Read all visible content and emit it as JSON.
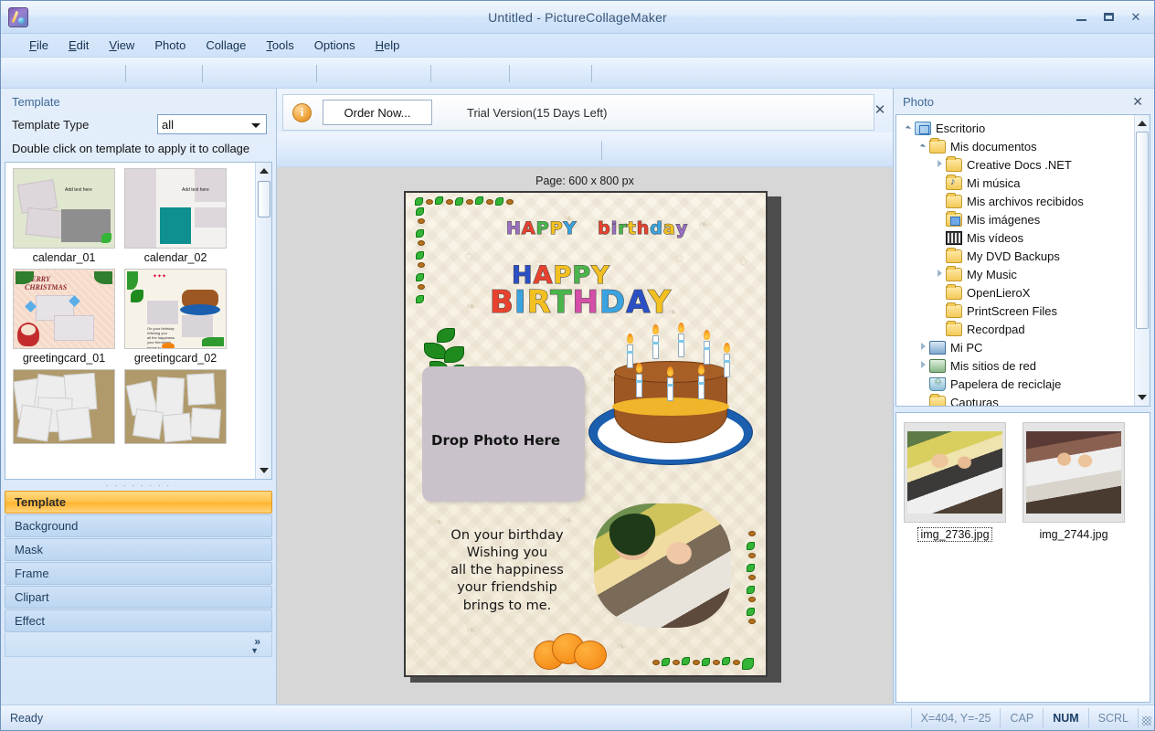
{
  "window": {
    "title": "Untitled - PictureCollageMaker",
    "icon": "app-icon",
    "minimize": "–",
    "maximize": "❐",
    "close": "✕"
  },
  "menu": {
    "items": [
      {
        "label": "File",
        "accel": "F"
      },
      {
        "label": "Edit",
        "accel": "E"
      },
      {
        "label": "View",
        "accel": "V"
      },
      {
        "label": "Photo",
        "accel": ""
      },
      {
        "label": "Collage",
        "accel": ""
      },
      {
        "label": "Tools",
        "accel": "T"
      },
      {
        "label": "Options",
        "accel": ""
      },
      {
        "label": "Help",
        "accel": "H"
      }
    ]
  },
  "left_panel": {
    "header": "Template",
    "template_type_label": "Template Type",
    "template_type_value": "all",
    "template_type_options": [
      "all"
    ],
    "hint": "Double click on template to apply it to collage",
    "templates": [
      {
        "name": "calendar_01"
      },
      {
        "name": "calendar_02"
      },
      {
        "name": "greetingcard_01"
      },
      {
        "name": "greetingcard_02"
      },
      {
        "name": ""
      },
      {
        "name": ""
      }
    ],
    "categories": [
      {
        "label": "Template",
        "active": true
      },
      {
        "label": "Background",
        "active": false
      },
      {
        "label": "Mask",
        "active": false
      },
      {
        "label": "Frame",
        "active": false
      },
      {
        "label": "Clipart",
        "active": false
      },
      {
        "label": "Effect",
        "active": false
      }
    ],
    "more_chevron": "»"
  },
  "trial": {
    "info_icon": "info-icon",
    "order_button": "Order Now...",
    "message": "Trial Version(15 Days Left)",
    "close": "✕"
  },
  "canvas": {
    "page_label": "Page: 600 x 800 px",
    "collage": {
      "title_small": "happy birthday",
      "title_big_line1": "HAPPY",
      "title_big_line2": "BIRTHDAY",
      "drop_text": "Drop Photo Here",
      "verse_lines": [
        "On your birthday",
        "Wishing you",
        "all the happiness",
        "your friendship",
        "brings to me."
      ],
      "title_small_colors": [
        "#9b6fc4",
        "#e8422e",
        "#4ab54a",
        "#f2c020",
        "#3aa3e0",
        "#e8422e",
        "#9b6fc4",
        "#4ab54a",
        "#f2c020",
        "#e8422e",
        "#3aa3e0",
        "#9b6fc4",
        "#4ab54a"
      ],
      "title_big_colors_line1": [
        "#2b4fc4",
        "#e8422e",
        "#f2c020",
        "#4ab54a",
        "#f2c020"
      ],
      "title_big_colors_line2": [
        "#e8422e",
        "#3aa3e0",
        "#f2c020",
        "#4ab54a",
        "#d44fa8",
        "#3aa3e0",
        "#2b4fc4",
        "#e8422e",
        "#f2c020"
      ],
      "candle_count": 8
    }
  },
  "right_panel": {
    "header": "Photo",
    "close": "✕",
    "tree": [
      {
        "label": "Escritorio",
        "depth": 0,
        "icon": "desktop-icon",
        "expander": "down"
      },
      {
        "label": "Mis documentos",
        "depth": 1,
        "icon": "folder-icon",
        "expander": "down"
      },
      {
        "label": "Creative Docs .NET",
        "depth": 2,
        "icon": "folder-icon",
        "expander": "right"
      },
      {
        "label": "Mi música",
        "depth": 2,
        "icon": "music-folder-icon",
        "expander": "none"
      },
      {
        "label": "Mis archivos recibidos",
        "depth": 2,
        "icon": "folder-icon",
        "expander": "none"
      },
      {
        "label": "Mis imágenes",
        "depth": 2,
        "icon": "pictures-folder-icon",
        "expander": "none"
      },
      {
        "label": "Mis vídeos",
        "depth": 2,
        "icon": "videos-folder-icon",
        "expander": "none"
      },
      {
        "label": "My DVD Backups",
        "depth": 2,
        "icon": "folder-icon",
        "expander": "none"
      },
      {
        "label": "My Music",
        "depth": 2,
        "icon": "folder-icon",
        "expander": "right"
      },
      {
        "label": "OpenLieroX",
        "depth": 2,
        "icon": "folder-icon",
        "expander": "none"
      },
      {
        "label": "PrintScreen Files",
        "depth": 2,
        "icon": "folder-icon",
        "expander": "none"
      },
      {
        "label": "Recordpad",
        "depth": 2,
        "icon": "folder-icon",
        "expander": "none"
      },
      {
        "label": "Mi PC",
        "depth": 1,
        "icon": "computer-icon",
        "expander": "right"
      },
      {
        "label": "Mis sitios de red",
        "depth": 1,
        "icon": "network-icon",
        "expander": "right"
      },
      {
        "label": "Papelera de reciclaje",
        "depth": 1,
        "icon": "recycle-bin-icon",
        "expander": "none"
      },
      {
        "label": "Capturas",
        "depth": 1,
        "icon": "folder-icon",
        "expander": "none"
      }
    ],
    "photos": [
      {
        "name": "img_2736.jpg",
        "selected": true
      },
      {
        "name": "img_2744.jpg",
        "selected": false
      }
    ]
  },
  "statusbar": {
    "ready": "Ready",
    "coords": "X=404, Y=-25",
    "cap": "CAP",
    "num": "NUM",
    "scrl": "SCRL"
  }
}
